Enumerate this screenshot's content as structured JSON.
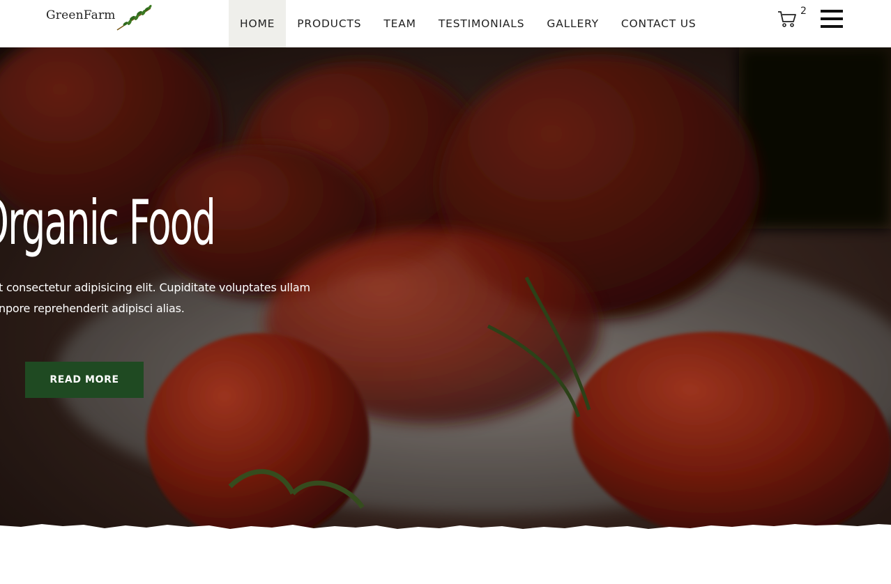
{
  "header": {
    "logo_text": "GreenFarm",
    "nav": [
      {
        "label": "HOME",
        "active": true
      },
      {
        "label": "PRODUCTS",
        "active": false
      },
      {
        "label": "TEAM",
        "active": false
      },
      {
        "label": "TESTIMONIALS",
        "active": false
      },
      {
        "label": "GALLERY",
        "active": false
      },
      {
        "label": "CONTACT US",
        "active": false
      }
    ],
    "cart_count": "2",
    "cart_icon": "cart-icon",
    "menu_icon": "hamburger-menu-icon"
  },
  "hero": {
    "title": "Organic Food",
    "text_line1": "t consectetur adipisicing elit. Cupiditate voluptates ullam",
    "text_line2": "npore reprehenderit adipisci alias.",
    "button_label": "READ MORE",
    "button_color": "#1f4a22"
  }
}
